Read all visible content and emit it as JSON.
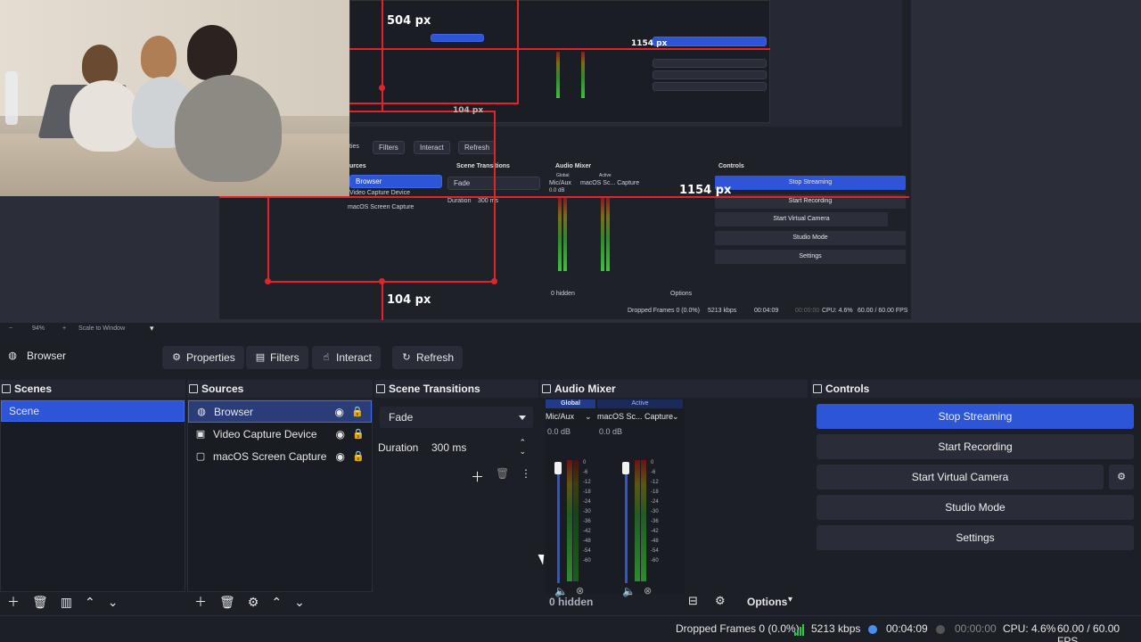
{
  "preview": {
    "label_504": "504 px",
    "label_1154_inner": "1154 px",
    "label_1154": "1154 px",
    "label_104_inner": "104 px",
    "label_104": "104 px",
    "mini": {
      "tabs": [
        "Filters",
        "Interact",
        "Refresh"
      ],
      "sources_header": "Sources",
      "sources": [
        "Browser",
        "Video Capture Device",
        "macOS Screen Capture"
      ],
      "transitions_header": "Scene Transitions",
      "transition": "Fade",
      "duration_label": "Duration",
      "duration_value": "300 ms",
      "mixer_header": "Audio Mixer",
      "mixer_global": "Global",
      "mixer_active": "Active",
      "mixer_mic": "Mic/Aux",
      "mixer_cap": "macOS Sc... Capture",
      "mixer_db": "0.0 dB",
      "hidden": "0 hidden",
      "options": "Options",
      "controls_header": "Controls",
      "controls": [
        "Stop Streaming",
        "Start Recording",
        "Start Virtual Camera",
        "Studio Mode",
        "Settings"
      ],
      "status": "Dropped Frames 0 (0.0%)",
      "kbps": "5213 kbps",
      "time": "00:04:09",
      "rec_time": "00:00:00",
      "cpu": "CPU: 4.6%",
      "fps": "60.00 / 60.00 FPS"
    }
  },
  "zoombar": {
    "zoom": "94%",
    "scale": "Scale to Window"
  },
  "toolbar": {
    "source_name": "Browser",
    "properties": "Properties",
    "filters": "Filters",
    "interact": "Interact",
    "refresh": "Refresh"
  },
  "scenes": {
    "title": "Scenes",
    "items": [
      "Scene"
    ]
  },
  "sources": {
    "title": "Sources",
    "items": [
      "Browser",
      "Video Capture Device",
      "macOS Screen Capture"
    ]
  },
  "transitions": {
    "title": "Scene Transitions",
    "selected": "Fade",
    "duration_label": "Duration",
    "duration_value": "300 ms"
  },
  "mixer": {
    "title": "Audio Mixer",
    "global_tab": "Global",
    "active_tab": "Active",
    "channels": [
      {
        "name": "Mic/Aux",
        "db": "0.0 dB"
      },
      {
        "name": "macOS Sc... Capture",
        "db": "0.0 dB"
      }
    ],
    "scale": [
      "0",
      "-6",
      "-12",
      "-18",
      "-24",
      "-30",
      "-36",
      "-42",
      "-48",
      "-54",
      "-60"
    ],
    "hidden": "0 hidden",
    "options": "Options"
  },
  "controls": {
    "title": "Controls",
    "stop_streaming": "Stop Streaming",
    "start_recording": "Start Recording",
    "start_virtual_camera": "Start Virtual Camera",
    "studio_mode": "Studio Mode",
    "settings": "Settings"
  },
  "status": {
    "dropped": "Dropped Frames 0 (0.0%)",
    "kbps": "5213 kbps",
    "stream_time": "00:04:09",
    "rec_time": "00:00:00",
    "cpu": "CPU: 4.6%",
    "fps": "60.00 / 60.00 FPS"
  }
}
